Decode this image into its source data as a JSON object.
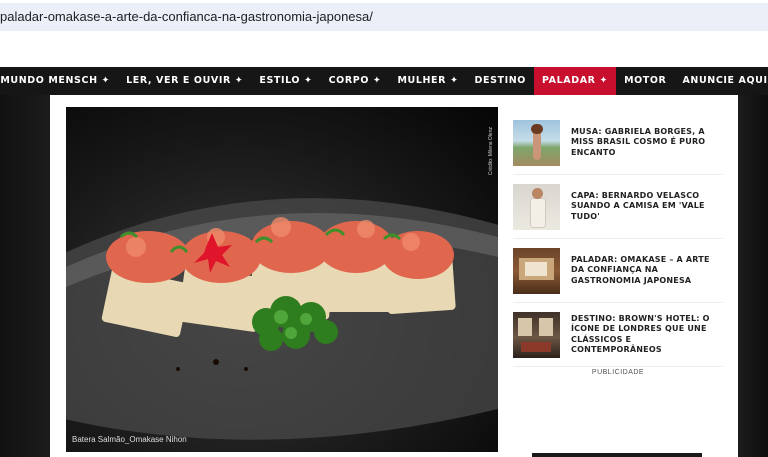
{
  "browser": {
    "url": "paladar-omakase-a-arte-da-confianca-na-gastronomia-japonesa/"
  },
  "nav": {
    "items": [
      {
        "label": "MUNDO MENSCH ✦"
      },
      {
        "label": "LER, VER E OUVIR ✦"
      },
      {
        "label": "ESTILO ✦"
      },
      {
        "label": "CORPO ✦"
      },
      {
        "label": "MULHER ✦"
      },
      {
        "label": "DESTINO"
      },
      {
        "label": "PALADAR ✦"
      },
      {
        "label": "MOTOR"
      },
      {
        "label": "ANUNCIE AQUI"
      }
    ],
    "active_index": 6,
    "active_color": "#c8102e"
  },
  "hero": {
    "caption": "Batera Salmão_Omakase Nihon",
    "credit": "Crédito: Milena Olenz"
  },
  "sidebar": {
    "posts": [
      {
        "title": "MUSA: GABRIELA BORGES, A MISS BRASIL COSMO É PURO ENCANTO",
        "thumb_icon": "beach-photo-icon"
      },
      {
        "title": "CAPA: BERNARDO VELASCO SUANDO A CAMISA EM 'VALE TUDO'",
        "thumb_icon": "portrait-photo-icon"
      },
      {
        "title": "PALADAR: OMAKASE – A ARTE DA CONFIANÇA NA GASTRONOMIA JAPONESA",
        "thumb_icon": "restaurant-photo-icon"
      },
      {
        "title": "DESTINO: BROWN'S HOTEL: O ÍCONE DE LONDRES QUE UNE CLÁSSICOS E CONTEMPORÂNEOS",
        "thumb_icon": "hotel-photo-icon"
      }
    ],
    "ad_label": "PUBLICIDADE"
  }
}
